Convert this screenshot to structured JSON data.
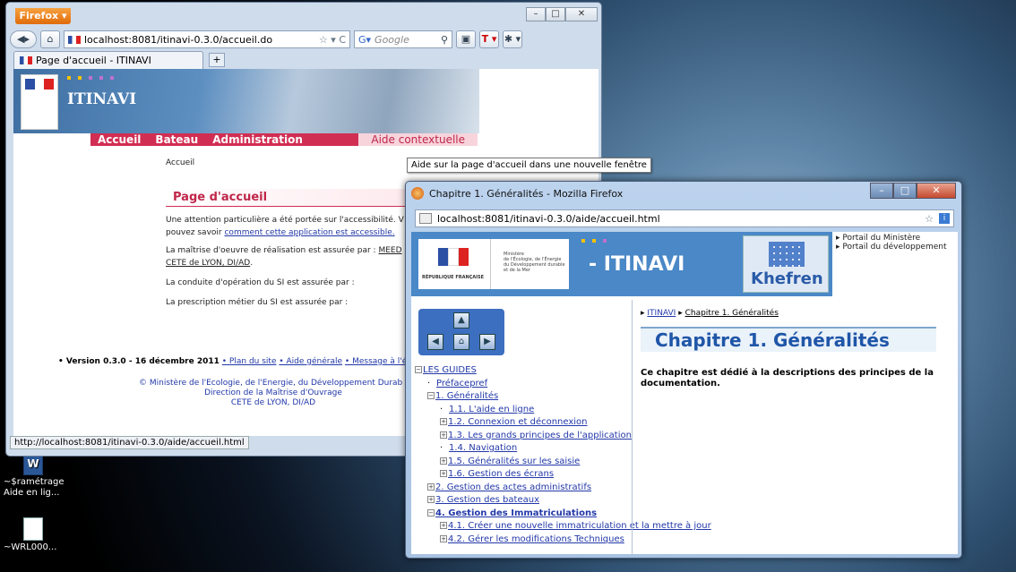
{
  "main_window": {
    "app_button": "Firefox",
    "url": "localhost:8081/itinavi-0.3.0/accueil.do",
    "search_placeholder": "Google",
    "tab_label": "Page d'accueil - ITINAVI",
    "site_title": "ITINAVI",
    "menu": [
      "Accueil",
      "Bateau",
      "Administration",
      "Aide contextuelle"
    ],
    "breadcrumb": "Accueil",
    "page_title": "Page d'accueil",
    "para1_text": "Une attention particulière a été portée sur l'accessibilité. V",
    "para1_text2": "pouvez savoir ",
    "para1_link": "comment cette application est accessible.",
    "para2_text": "La maîtrise d'oeuvre de réalisation est assurée par : ",
    "para2_link1": "MEED",
    "para2_link2": "CETE de LYON, DI/AD",
    "para2_tail": ".",
    "para3": "La conduite d'opération du SI est assurée par :",
    "para4": "La prescription métier du SI est assurée par :",
    "footer_version": "• Version 0.3.0 - 16 décembre 2011",
    "footer_links": [
      "• Plan du site",
      "• Aide générale",
      "• Message à l'é"
    ],
    "footer_line1": "© Ministère de l'Ecologie, de l'Energie, du Développement Durab",
    "footer_line2": "Direction de la Maîtrise d'Ouvrage",
    "footer_line3": "CETE de LYON, DI/AD",
    "status_url": "http://localhost:8081/itinavi-0.3.0/aide/accueil.html"
  },
  "tooltip": "Aide sur la page d'accueil dans une nouvelle fenêtre",
  "help_window": {
    "title": "Chapitre 1.  Généralités - Mozilla Firefox",
    "url": "localhost:8081/itinavi-0.3.0/aide/accueil.html",
    "site_title": "- ITINAVI",
    "khefren": "Khefren",
    "ministry_lines": [
      "Ministère",
      "de l'Écologie, de l'Énergie",
      "du Développement durable",
      "et de la Mer"
    ],
    "logo_text": "RÉPUBLIQUE FRANÇAISE",
    "right_links": [
      "Portail du Ministère",
      "Portail du développement"
    ],
    "breadcrumb": [
      "ITINAVI",
      "Chapitre 1.  Généralités"
    ],
    "chapter_title": "Chapitre 1.  Généralités",
    "chapter_desc": "Ce chapitre est dédié à la descriptions des principes de la documentation.",
    "toc": [
      {
        "label": "LES GUIDES",
        "level": 0,
        "sign": "−"
      },
      {
        "label": "Préfacepref",
        "level": 1,
        "sign": ""
      },
      {
        "label": "1. Généralités",
        "level": 1,
        "sign": "−"
      },
      {
        "label": "1.1. L'aide en ligne",
        "level": 2,
        "sign": ""
      },
      {
        "label": "1.2. Connexion et déconnexion",
        "level": 2,
        "sign": "+"
      },
      {
        "label": "1.3. Les grands principes de l'application",
        "level": 2,
        "sign": "+"
      },
      {
        "label": "1.4. Navigation",
        "level": 2,
        "sign": ""
      },
      {
        "label": "1.5. Généralités sur les saisie",
        "level": 2,
        "sign": "+"
      },
      {
        "label": "1.6. Gestion des écrans",
        "level": 2,
        "sign": "+"
      },
      {
        "label": "2. Gestion des actes administratifs",
        "level": 1,
        "sign": "+"
      },
      {
        "label": "3. Gestion des bateaux",
        "level": 1,
        "sign": "+"
      },
      {
        "label": "4. Gestion des Immatriculations",
        "level": 1,
        "sign": "−",
        "bold": true
      },
      {
        "label": "4.1. Créer une nouvelle immatriculation et la mettre à jour",
        "level": 2,
        "sign": "+"
      },
      {
        "label": "4.2. Gérer les modifications Techniques",
        "level": 2,
        "sign": "+"
      }
    ]
  },
  "desktop_icons": [
    {
      "label": "~$ramétrage Aide en lig...",
      "icon": "word-doc-icon"
    },
    {
      "label": "~WRL000...",
      "icon": "file-icon"
    }
  ]
}
